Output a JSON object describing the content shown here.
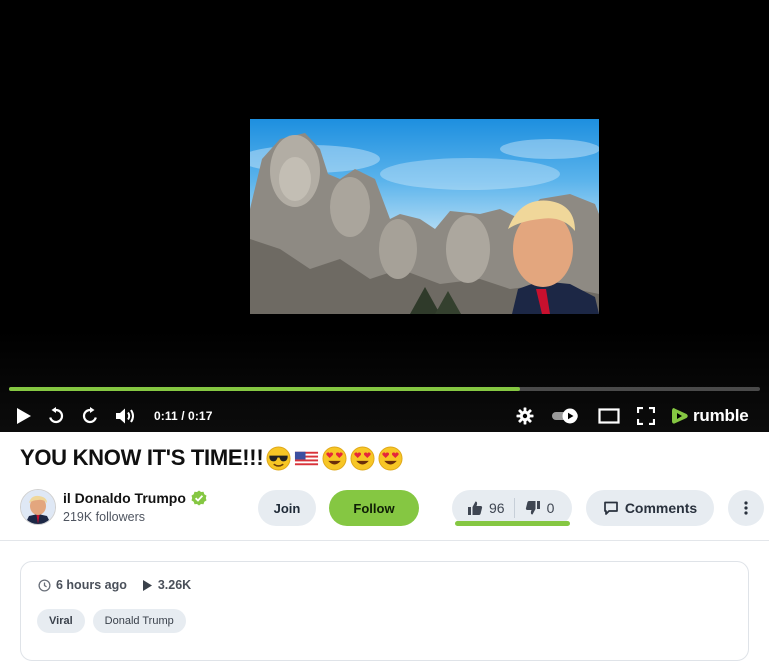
{
  "player": {
    "time_display": "0:11 / 0:17",
    "progress_fraction": 0.68,
    "brand_name": "rumble",
    "icons": [
      "play-icon",
      "replay-icon",
      "forward-icon",
      "volume-icon",
      "gear-icon",
      "toggle-icon",
      "theater-icon",
      "fullscreen-icon",
      "rumble-logo-icon"
    ]
  },
  "video": {
    "title": "YOU KNOW IT'S TIME!!!",
    "title_emojis": [
      "smiling-face-with-sunglasses",
      "us-flag",
      "heart-eyes",
      "heart-eyes",
      "heart-eyes"
    ]
  },
  "channel": {
    "name": "il Donaldo Trumpo",
    "verified": true,
    "followers": "219K followers"
  },
  "actions": {
    "join_label": "Join",
    "follow_label": "Follow",
    "likes": "96",
    "dislikes": "0",
    "comments_label": "Comments"
  },
  "details": {
    "posted": "6 hours ago",
    "views": "3.26K",
    "tags": [
      "Viral",
      "Donald Trump"
    ]
  },
  "colors": {
    "accent": "#85c742",
    "pill_bg": "#e7ecf1",
    "player_bg": "#000000"
  }
}
